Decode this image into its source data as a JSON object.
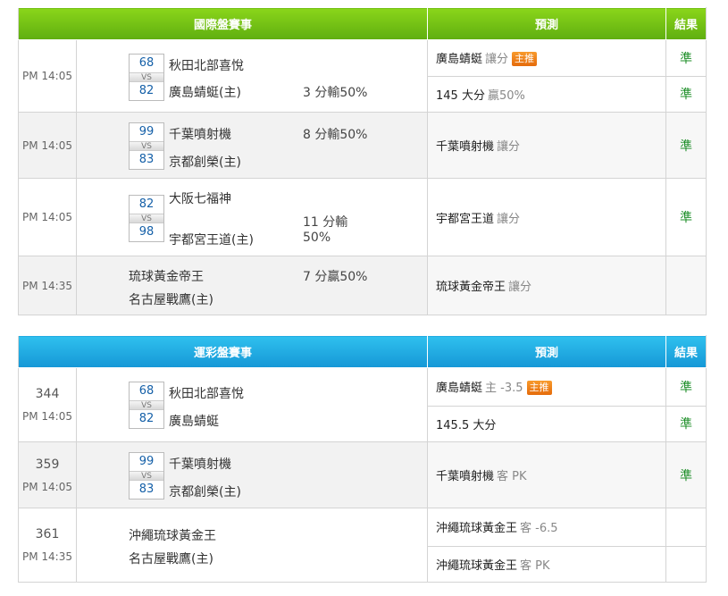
{
  "intl": {
    "headers": {
      "game": "國際盤賽事",
      "pred": "預測",
      "result": "結果"
    },
    "rows": [
      {
        "time": "PM 14:05",
        "score_top": "68",
        "score_bot": "82",
        "vs": "VS",
        "away": "秋田北部喜悅",
        "home": "廣島蜻蜓(主)",
        "line": "3 分輸50%",
        "pred1_team": "廣島蜻蜓",
        "pred1_sub": "讓分",
        "pred1_badge": "主推",
        "res1": "準",
        "pred2_team": "145 大分",
        "pred2_sub": "贏50%",
        "res2": "準"
      },
      {
        "time": "PM 14:05",
        "score_top": "99",
        "score_bot": "83",
        "vs": "VS",
        "away": "千葉噴射機",
        "home": "京都創榮(主)",
        "line": "8 分輸50%",
        "pred1_team": "千葉噴射機",
        "pred1_sub": "讓分",
        "res1": "準"
      },
      {
        "time": "PM 14:05",
        "score_top": "82",
        "score_bot": "98",
        "vs": "VS",
        "away": "大阪七福神",
        "home": "宇都宮王道(主)",
        "line_a": "11 分輸",
        "line_b": "50%",
        "pred1_team": "宇都宮王道",
        "pred1_sub": "讓分",
        "res1": "準"
      },
      {
        "time": "PM 14:35",
        "away": "琉球黃金帝王",
        "home": "名古屋戰鷹(主)",
        "line": "7 分贏50%",
        "pred1_team": "琉球黃金帝王",
        "pred1_sub": "讓分",
        "res1": ""
      }
    ]
  },
  "lottery": {
    "headers": {
      "game": "運彩盤賽事",
      "pred": "預測",
      "result": "結果"
    },
    "rows": [
      {
        "num": "344",
        "time": "PM 14:05",
        "score_top": "68",
        "score_bot": "82",
        "vs": "VS",
        "away": "秋田北部喜悅",
        "home": "廣島蜻蜓",
        "pred1_team": "廣島蜻蜓",
        "pred1_sub": "主 -3.5",
        "pred1_badge": "主推",
        "res1": "準",
        "pred2_team": "145.5 大分",
        "res2": "準"
      },
      {
        "num": "359",
        "time": "PM 14:05",
        "score_top": "99",
        "score_bot": "83",
        "vs": "VS",
        "away": "千葉噴射機",
        "home": "京都創榮(主)",
        "pred1_team": "千葉噴射機",
        "pred1_sub": "客 PK",
        "res1": "準"
      },
      {
        "num": "361",
        "time": "PM 14:35",
        "away": "沖繩琉球黃金王",
        "home": "名古屋戰鷹(主)",
        "pred1_team": "沖繩琉球黃金王",
        "pred1_sub": "客 -6.5",
        "res1": "",
        "pred2_team": "沖繩琉球黃金王",
        "pred2_sub": "客 PK",
        "res2": ""
      }
    ]
  },
  "colors": {
    "intl_header": "#6cc114",
    "lottery_header": "#1fa9e2",
    "badge": "#f07d18",
    "result": "#1f8f2a",
    "score": "#1560a8"
  }
}
